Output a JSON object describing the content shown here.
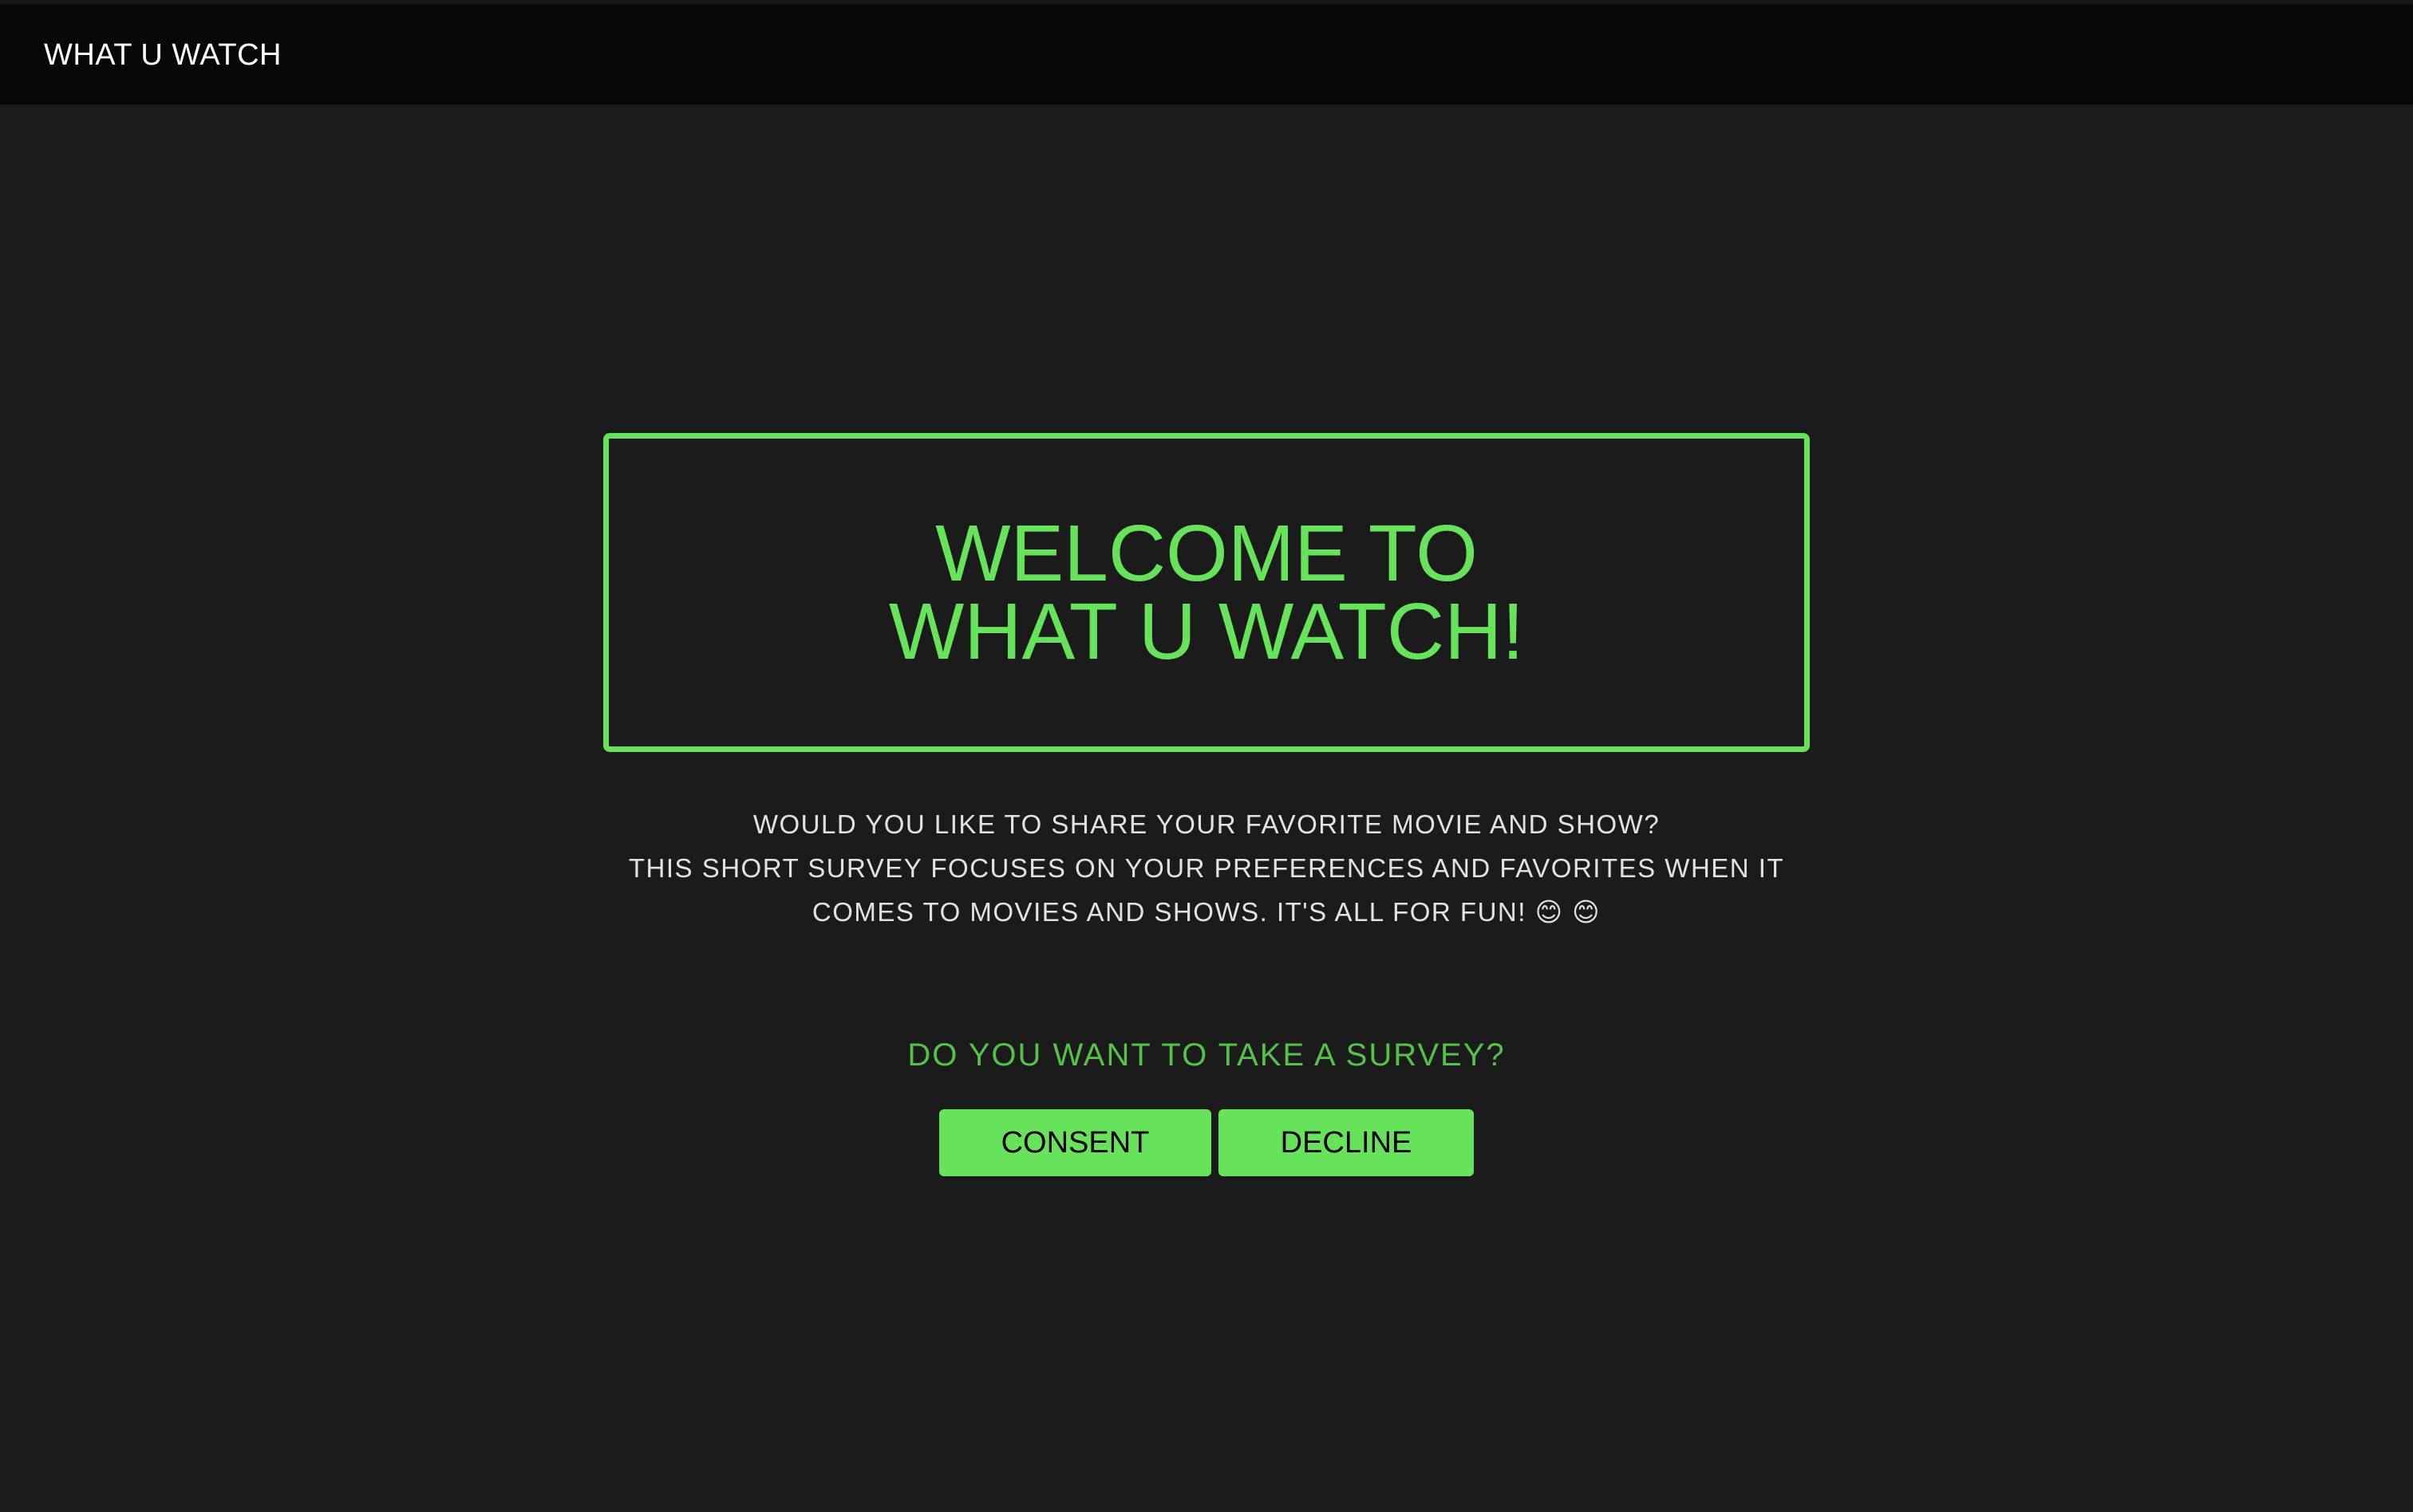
{
  "header": {
    "brand": "WHAT U WATCH"
  },
  "hero": {
    "line1": "WELCOME TO",
    "line2": "WHAT U WATCH!"
  },
  "intro": {
    "line1": "WOULD YOU LIKE TO SHARE YOUR FAVORITE MOVIE AND SHOW?",
    "line2": "THIS SHORT SURVEY FOCUSES ON YOUR PREFERENCES AND FAVORITES WHEN IT",
    "line3": "COMES TO MOVIES AND SHOWS. IT'S ALL FOR FUN! 😊 😊"
  },
  "survey": {
    "question": "DO YOU WANT TO TAKE A SURVEY?",
    "consent_label": "CONSENT",
    "decline_label": "DECLINE"
  },
  "colors": {
    "background": "#1b1b1b",
    "topbar": "#070707",
    "accent": "#66e25b",
    "question": "#56c04d",
    "text": "#e2e2e2"
  }
}
